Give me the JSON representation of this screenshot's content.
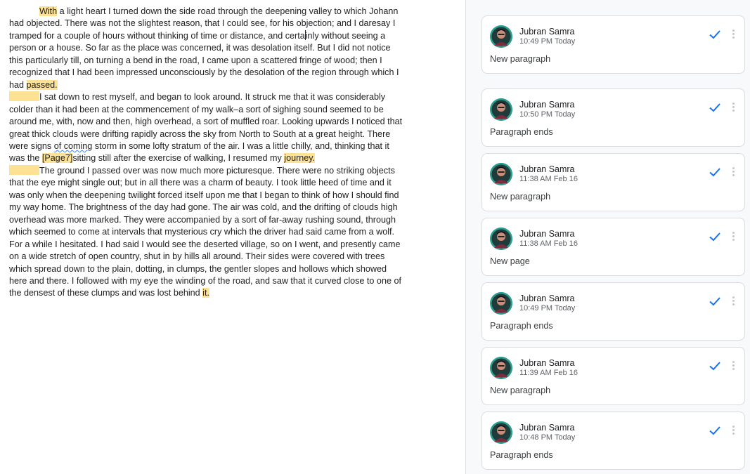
{
  "document": {
    "p1": {
      "t1": "With",
      "t2": " a light heart I turned down the side road through the deepening valley to which Johann had objected. There was not the slightest reason, that I could see, for his objection; and I daresay I tramped for a couple of hours without thinking of time or distance, and certa",
      "t3": "inly without seeing a person or a house. So far as the place was concerned, it was desolation itself. But I did not notice this particularly till, on turning a bend in the road, I came upon a scattered fringe of wood; then I recognized that I had been impressed unconsciously by the desolation of the region through which I had ",
      "t4": "passed."
    },
    "p2": {
      "t1": "I sat down to rest myself, and began to look around. It struck me that it was considerably colder than it had been at the commencement of my walk–a sort of sighing sound seemed to be around me, with, now and then, high overhead, a sort of muffled roar. Looking upwards I noticed that great thick clouds were drifting rapidly across the sky from North to South at a great height. There were signs ",
      "t2": "of coming",
      "t3": " storm in some lofty stratum of the air. I was a little chilly, and, thinking that it was the ",
      "t4": "[Page7]",
      "t5": "sitting still after the exercise of walking, I resumed my ",
      "t6": "journey."
    },
    "p3": {
      "t1": "The ground I passed over was now much more picturesque. There were no striking objects that the eye might single out; but in all there was a charm of beauty. I took little heed of time and it was only when the deepening twilight forced itself upon me that I began to think of how I should find my way home. The brightness of the day had gone. The air was cold, and the drifting of clouds high overhead was more marked. They were accompanied by a sort of far-away rushing sound, through which seemed to come at intervals that mysterious cry which the driver had said came from a wolf. For a while I hesitated. I had said I would see the deserted village, so on I went, and presently came on a wide stretch of open country, shut in by hills all around. Their sides were covered with trees which spread down to the plain, dotting, in clumps, the gentler slopes and hollows which showed here and there. I followed with my eye the winding of the road, and saw that it curved close to one of the densest of these clumps and was lost behind ",
      "t2": "it."
    }
  },
  "comments": [
    {
      "author": "Jubran Samra",
      "time": "10:49 PM Today",
      "text": "New paragraph"
    },
    {
      "author": "Jubran Samra",
      "time": "10:50 PM Today",
      "text": "Paragraph ends"
    },
    {
      "author": "Jubran Samra",
      "time": "11:38 AM Feb 16",
      "text": "New paragraph"
    },
    {
      "author": "Jubran Samra",
      "time": "11:38 AM Feb 16",
      "text": "New page"
    },
    {
      "author": "Jubran Samra",
      "time": "10:49 PM Today",
      "text": "Paragraph ends"
    },
    {
      "author": "Jubran Samra",
      "time": "11:39 AM Feb 16",
      "text": "New paragraph"
    },
    {
      "author": "Jubran Samra",
      "time": "10:48 PM Today",
      "text": "Paragraph ends"
    }
  ],
  "icons": {
    "resolve": "check-icon",
    "more": "more-vert-icon",
    "avatar": "user-avatar"
  },
  "colors": {
    "highlight": "#fde293",
    "accent": "#1a73e8",
    "spelling_underline": "#4285f4"
  }
}
